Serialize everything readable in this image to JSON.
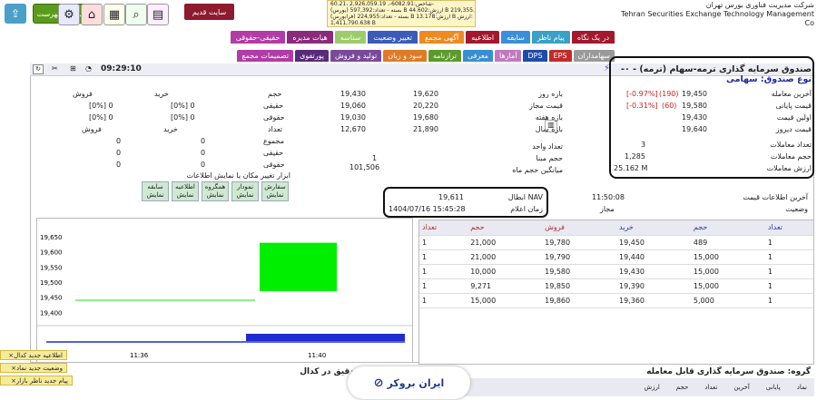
{
  "header": {
    "company_fa": "شرکت مدیریت فناوری بورس تهران",
    "company_en": "Tehran Securities Exchange Technology Management Co",
    "ticker": {
      "line1": "شاخص:6082.91-، 2,926,059.19 ،60.21-",
      "line2": "(بورس) بسته - تعداد:597,392 B ارزش:44.602 B ارزش:219,355.001 B",
      "line3": "(فرابورس) بسته - تعداد:224,955 B ارزش:13.178 B ارزش:",
      "line4": "1,411,790.638 B"
    },
    "old_site_label": "سایت قدیم",
    "watchlist_label": "نمایش فهرست"
  },
  "nav": {
    "tabs": [
      {
        "label": "در یک نگاه",
        "color": "#a3182c"
      },
      {
        "label": "پیام ناظر",
        "color": "#3aa0c8"
      },
      {
        "label": "سابقه",
        "color": "#3a8fd8"
      },
      {
        "label": "اطلاعیه",
        "color": "#a3182c"
      },
      {
        "label": "آگهی مجمع",
        "color": "#ee8a22"
      },
      {
        "label": "تغییر وضعیت",
        "color": "#3c5ab8"
      },
      {
        "label": "سناسه",
        "color": "#9ccc6a"
      },
      {
        "label": "هیات مدیره",
        "color": "#8a2a7a"
      },
      {
        "label": "حقیقی-حقوقی",
        "color": "#b23ca6"
      }
    ],
    "subtabs": [
      {
        "label": "سهامداران",
        "color": "#9a9a9a"
      },
      {
        "label": "EPS",
        "color": "#c02c2c"
      },
      {
        "label": "DPS",
        "color": "#1f4ca8"
      },
      {
        "label": "آمارها",
        "color": "#c27abf"
      },
      {
        "label": "معرفی",
        "color": "#3a8ed0"
      },
      {
        "label": "ترازنامه",
        "color": "#5c9a2c"
      },
      {
        "label": "سود و زیان",
        "color": "#e07a26"
      },
      {
        "label": "تولید و فروش",
        "color": "#7a4a9a"
      },
      {
        "label": "پورتفوی",
        "color": "#5a2a7a"
      },
      {
        "label": "تصمیمات مجمع",
        "color": "#b03ca8"
      }
    ]
  },
  "instrument": {
    "title": "صندوق سرمایه گذاری ترمه-سهام (ترمه) - ۰-",
    "type": "نوع صندوق: سهامی",
    "time": "09:29:10"
  },
  "price_info": {
    "last_trade_label": "آخرین معامله",
    "last_trade": "19,450",
    "last_change": "(190)",
    "last_pct": "[-0.97%]",
    "close_label": "قیمت پایانی",
    "close": "19,580",
    "close_change": "(60)",
    "close_pct": "[-0.31%]",
    "first_label": "اولین قیمت",
    "first": "19,430",
    "yesterday_label": "قیمت دیروز",
    "yesterday": "19,640",
    "count_label": "تعداد معاملات",
    "count": "3",
    "volume_label": "حجم معاملات",
    "volume": "1,285",
    "value_label": "ارزش معاملات",
    "value": "25.162 M"
  },
  "ranges": {
    "day_label": "بازه روز",
    "day_low": "19,430",
    "day_high": "19,620",
    "allowed_label": "قیمت مجاز",
    "allowed_low": "19,060",
    "allowed_high": "20,220",
    "week_label": "بازه هفته",
    "week_low": "19,030",
    "week_high": "19,680",
    "year_label": "بازه سال",
    "year_low": "12,670",
    "year_high": "21,890",
    "unit_label": "تعداد واحد",
    "base_label": "حجم مبنا",
    "base": "1",
    "avg_month_label": "میانگین حجم ماه",
    "avg_month": "101,506"
  },
  "client": {
    "buy": "خرید",
    "sell": "فروش",
    "vol": "حجم",
    "real": "حقیقی",
    "legal": "حقوقی",
    "count": "تعداد",
    "total": "مجموع",
    "real_buy": "[0%] 0",
    "real_sell": "[0%] 0",
    "legal_buy": "[0%] 0",
    "legal_sell": "[0%] 0",
    "count_buy": "خرید",
    "count_sell": "فروش",
    "total_buy": "0",
    "total_sell": "0",
    "creal_buy": "0",
    "creal_sell": "0",
    "clegal_buy": "0",
    "clegal_sell": "0",
    "tools_note": "ابزار تغییر مکان یا نمایش اطلاعات"
  },
  "tools": [
    {
      "a": "سفارش",
      "b": "نمایش"
    },
    {
      "a": "نمودار",
      "b": "نمایش"
    },
    {
      "a": "همگروه",
      "b": "نمایش"
    },
    {
      "a": "اطلاعیه",
      "b": "نمایش"
    },
    {
      "a": "سابقه",
      "b": "نمایش"
    }
  ],
  "nav_info": {
    "nav_label": "NAV ابطال",
    "nav": "19,611",
    "nav_time_label": "زمان اعلام",
    "nav_time": "1404/07/16 15:45:28",
    "last_info_label": "آخرین اطلاعات قیمت",
    "last_info": "11:50:08",
    "status_label": "وضعیت",
    "status": "مجاز"
  },
  "orderbook": {
    "headers": [
      "تعداد",
      "حجم",
      "خرید",
      "فروش",
      "حجم",
      "تعداد"
    ],
    "rows": [
      [
        "1",
        "489",
        "19,450",
        "19,780",
        "21,000",
        "1"
      ],
      [
        "1",
        "15,000",
        "19,440",
        "19,790",
        "21,000",
        "1"
      ],
      [
        "1",
        "15,000",
        "19,430",
        "19,580",
        "10,000",
        "1"
      ],
      [
        "1",
        "15,000",
        "19,390",
        "19,850",
        "9,271",
        "1"
      ],
      [
        "1",
        "5,000",
        "19,360",
        "19,860",
        "15,000",
        "1"
      ]
    ]
  },
  "chart_data": {
    "type": "bar",
    "ylim": [
      19380,
      19680
    ],
    "yticks": [
      "19,650",
      "19,600",
      "19,550",
      "19,500",
      "19,450",
      "19,400"
    ],
    "xticks": [
      "11:36",
      "11:40"
    ],
    "bars": [
      {
        "x": "11:40",
        "low": 19470,
        "high": 19630,
        "color": "#00ee00"
      }
    ],
    "line": {
      "value": 19440,
      "color": "#66ee66"
    }
  },
  "bottom": {
    "group_label": "گروه: صندوق سرمایه گذاری قابل معامله",
    "minute_label": "اطلاعات دقیق در کدال",
    "brand": "ایران بروکر",
    "cols": [
      "نماد",
      "پایانی",
      "آخرین",
      "تعداد",
      "حجم",
      "ارزش"
    ],
    "notes": [
      "اطلاعیه جدید کدال",
      "وضعیت جدید نماد",
      "پیام جدید ناظر بازار"
    ]
  }
}
